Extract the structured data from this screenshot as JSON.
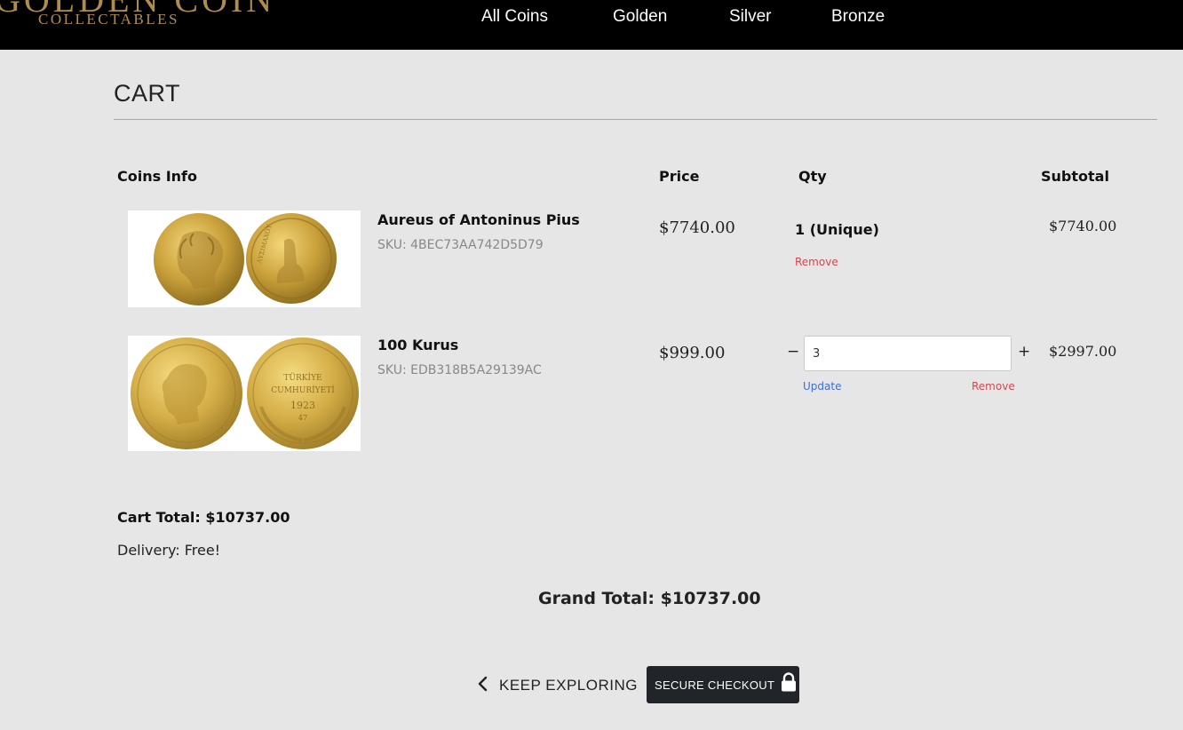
{
  "brand": {
    "name": "GOLDEN COIN",
    "subtitle": "COLLECTABLES"
  },
  "nav": [
    {
      "label": "All Coins"
    },
    {
      "label": "Golden"
    },
    {
      "label": "Silver"
    },
    {
      "label": "Bronze"
    }
  ],
  "cart": {
    "title": "CART",
    "columns": {
      "info": "Coins Info",
      "price": "Price",
      "qty": "Qty",
      "subtotal": "Subtotal"
    },
    "items": [
      {
        "name": "Aureus of Antoninus Pius",
        "sku": "SKU: 4BEC73AA742D5D79",
        "price": "$7740.00",
        "qty_label": "1 (Unique)",
        "subtotal": "$7740.00",
        "remove_label": "Remove"
      },
      {
        "name": "100 Kurus",
        "sku": "SKU: EDB318B5A29139AC",
        "price": "$999.00",
        "qty_value": "3",
        "decrement_label": "−",
        "increment_label": "+",
        "update_label": "Update",
        "remove_label": "Remove",
        "subtotal": "$2997.00"
      }
    ],
    "cart_total": "Cart Total: $10737.00",
    "delivery": "Delivery: Free!",
    "grand_total": "Grand Total: $10737.00"
  },
  "actions": {
    "keep_exploring": "KEEP EXPLORING",
    "checkout": "SECURE CHECKOUT"
  },
  "icons": {
    "back": "chevron-left-icon",
    "checkout": "lock-icon"
  },
  "colors": {
    "gold": "#b08d4f",
    "remove": "#d0484f",
    "update": "#3a6fd8",
    "checkout_bg": "#212529"
  }
}
